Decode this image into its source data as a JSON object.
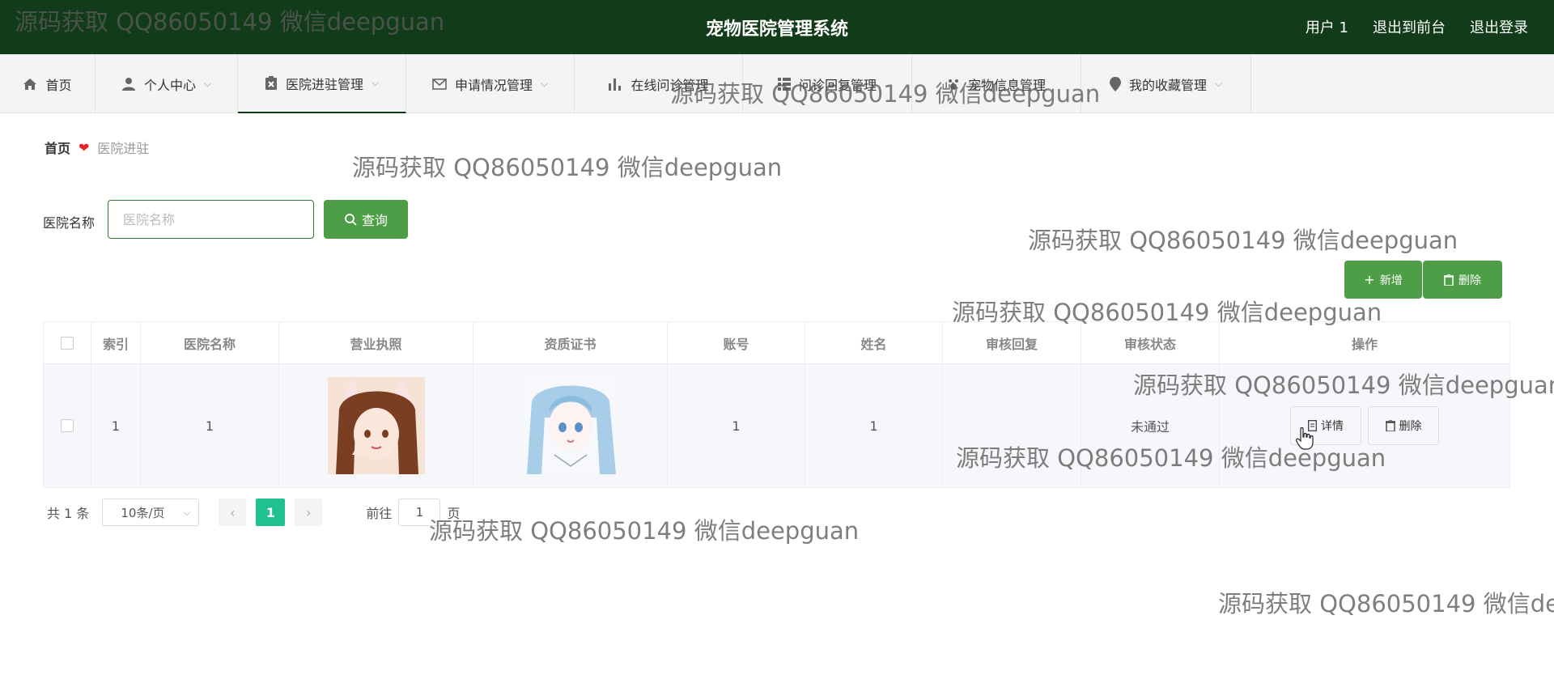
{
  "header": {
    "title": "宠物医院管理系统",
    "user": "用户 1",
    "back_to_front": "退出到前台",
    "logout": "退出登录"
  },
  "nav": {
    "items": [
      {
        "label": "首页",
        "icon": "home-icon"
      },
      {
        "label": "个人中心",
        "icon": "user-icon"
      },
      {
        "label": "医院进驻管理",
        "icon": "hospital-icon"
      },
      {
        "label": "申请情况管理",
        "icon": "mail-icon"
      },
      {
        "label": "在线问诊管理",
        "icon": "bar-chart-icon"
      },
      {
        "label": "问诊回复管理",
        "icon": "grid-icon"
      },
      {
        "label": "宠物信息管理",
        "icon": "paw-icon"
      },
      {
        "label": "我的收藏管理",
        "icon": "pin-icon"
      }
    ]
  },
  "breadcrumb": {
    "home": "首页",
    "current": "医院进驻"
  },
  "search": {
    "label": "医院名称",
    "placeholder": "医院名称",
    "value": "",
    "button": "查询"
  },
  "actions": {
    "add": "新增",
    "delete": "删除"
  },
  "table": {
    "headers": [
      "索引",
      "医院名称",
      "营业执照",
      "资质证书",
      "账号",
      "姓名",
      "审核回复",
      "审核状态",
      "操作"
    ],
    "rows": [
      {
        "index": "1",
        "name": "1",
        "license_img": "anime-girl-bunny-ears",
        "cert_img": "anime-girl-blue-hair",
        "account": "1",
        "person": "1",
        "reply": "",
        "status": "未通过",
        "detail_btn": "详情",
        "delete_btn": "删除"
      }
    ]
  },
  "pagination": {
    "total": "共 1 条",
    "page_size": "10条/页",
    "current_page": "1",
    "goto_label": "前往",
    "goto_value": "1",
    "page_suffix": "页"
  },
  "watermark": {
    "text": "源码获取 QQ86050149 微信deepguan"
  },
  "colors": {
    "header_bg": "#123b1a",
    "accent_green": "#4d9e47",
    "page_active": "#1ec18f",
    "heart": "#e8242b"
  }
}
